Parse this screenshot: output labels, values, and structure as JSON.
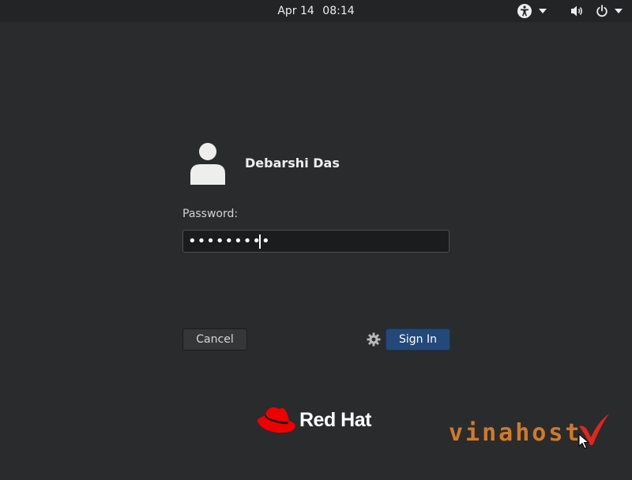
{
  "topbar": {
    "date": "Apr 14",
    "time": "08:14",
    "icons": [
      "accessibility-icon",
      "volume-icon",
      "power-icon"
    ]
  },
  "login": {
    "user_name": "Debarshi Das",
    "password_label": "Password:",
    "password_value": "•••••••••",
    "cancel_label": "Cancel",
    "signin_label": "Sign In"
  },
  "branding": {
    "logo_text": "Red Hat",
    "watermark_text": "vinahost"
  },
  "colors": {
    "background": "#2a2b2d",
    "signin_button": "#23497a",
    "redhat_red": "#ee0000",
    "watermark_orange": "#d07a2a",
    "watermark_red": "#e0261c"
  }
}
